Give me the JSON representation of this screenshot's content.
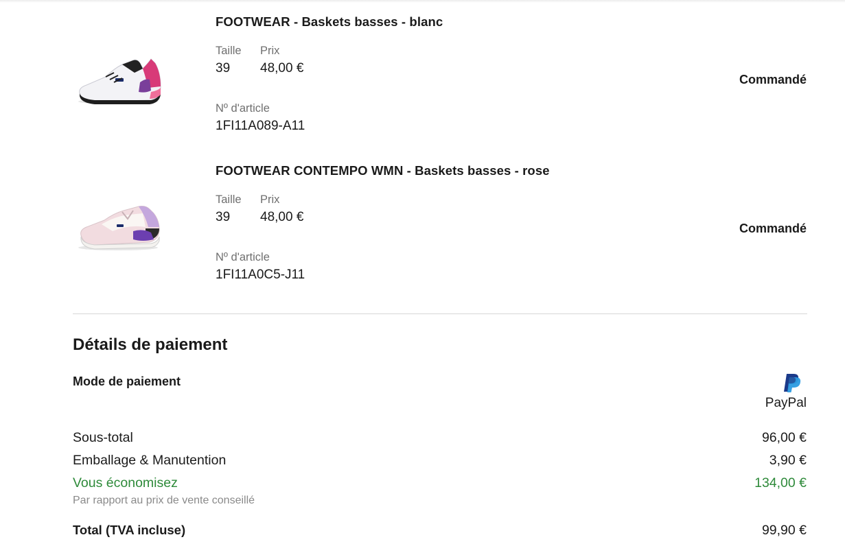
{
  "items": [
    {
      "name": "FOOTWEAR - Baskets basses - blanc",
      "size_label": "Taille",
      "size": "39",
      "price_label": "Prix",
      "price": "48,00 €",
      "article_label": "Nº d'article",
      "article": "1FI11A089-A11",
      "status": "Commandé",
      "image": "white-sneaker"
    },
    {
      "name": "FOOTWEAR CONTEMPO WMN - Baskets basses - rose",
      "size_label": "Taille",
      "size": "39",
      "price_label": "Prix",
      "price": "48,00 €",
      "article_label": "Nº d'article",
      "article": "1FI11A0C5-J11",
      "status": "Commandé",
      "image": "pink-sneaker"
    }
  ],
  "payment": {
    "title": "Détails de paiement",
    "mode_label": "Mode de paiement",
    "method_icon": "paypal-icon",
    "method_name": "PayPal",
    "subtotal_label": "Sous-total",
    "subtotal": "96,00 €",
    "shipping_label": "Emballage & Manutention",
    "shipping": "3,90 €",
    "savings_label": "Vous économisez",
    "savings": "134,00 €",
    "savings_note": "Par rapport au prix de vente conseillé",
    "total_label": "Total (TVA incluse)",
    "total": "99,90 €"
  },
  "colors": {
    "savings_green": "#2e8a3a",
    "muted_gray": "#6f6f6f",
    "paypal_dark": "#1b3a8a",
    "paypal_light": "#2c9be0"
  }
}
